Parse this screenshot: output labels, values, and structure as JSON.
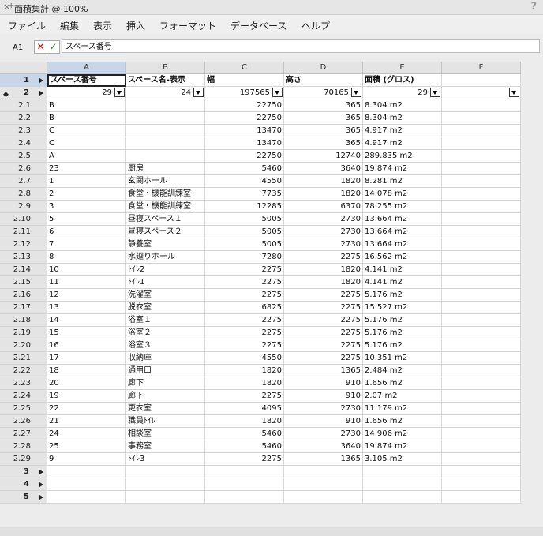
{
  "window": {
    "title": "面積集計 @ 100%",
    "help": "?"
  },
  "menu": [
    "ファイル",
    "編集",
    "表示",
    "挿入",
    "フォーマット",
    "データベース",
    "ヘルプ"
  ],
  "formula": {
    "cell_ref": "A1",
    "cancel": "✕",
    "accept": "✓",
    "value": "スペース番号"
  },
  "columns": [
    "A",
    "B",
    "C",
    "D",
    "E",
    "F"
  ],
  "header_row": {
    "num": "1",
    "cells": [
      "スペース番号",
      "スペース名-表示",
      "幅",
      "高さ",
      "面積 (グロス)",
      ""
    ]
  },
  "summary_row": {
    "num": "2",
    "cells": [
      "29",
      "24",
      "197565",
      "70165",
      "29",
      ""
    ]
  },
  "records": [
    {
      "n": "2.1",
      "c": [
        "B",
        "",
        "22750",
        "365",
        "8.304 m2"
      ]
    },
    {
      "n": "2.2",
      "c": [
        "B",
        "",
        "22750",
        "365",
        "8.304 m2"
      ]
    },
    {
      "n": "2.3",
      "c": [
        "C",
        "",
        "13470",
        "365",
        "4.917 m2"
      ]
    },
    {
      "n": "2.4",
      "c": [
        "C",
        "",
        "13470",
        "365",
        "4.917 m2"
      ]
    },
    {
      "n": "2.5",
      "c": [
        "A",
        "",
        "22750",
        "12740",
        "289.835 m2"
      ]
    },
    {
      "n": "2.6",
      "c": [
        "23",
        "厨房",
        "5460",
        "3640",
        "19.874 m2"
      ]
    },
    {
      "n": "2.7",
      "c": [
        "1",
        "玄関ホール",
        "4550",
        "1820",
        "8.281 m2"
      ]
    },
    {
      "n": "2.8",
      "c": [
        "2",
        "食堂・機能訓練室",
        "7735",
        "1820",
        "14.078 m2"
      ]
    },
    {
      "n": "2.9",
      "c": [
        "3",
        "食堂・機能訓練室",
        "12285",
        "6370",
        "78.255 m2"
      ]
    },
    {
      "n": "2.10",
      "c": [
        "5",
        "昼寝スペース１",
        "5005",
        "2730",
        "13.664 m2"
      ]
    },
    {
      "n": "2.11",
      "c": [
        "6",
        "昼寝スペース２",
        "5005",
        "2730",
        "13.664 m2"
      ]
    },
    {
      "n": "2.12",
      "c": [
        "7",
        "静養室",
        "5005",
        "2730",
        "13.664 m2"
      ]
    },
    {
      "n": "2.13",
      "c": [
        "8",
        "水廻りホール",
        "7280",
        "2275",
        "16.562 m2"
      ]
    },
    {
      "n": "2.14",
      "c": [
        "10",
        "ﾄｲﾚ2",
        "2275",
        "1820",
        "4.141 m2"
      ]
    },
    {
      "n": "2.15",
      "c": [
        "11",
        "ﾄｲﾚ1",
        "2275",
        "1820",
        "4.141 m2"
      ]
    },
    {
      "n": "2.16",
      "c": [
        "12",
        "洗濯室",
        "2275",
        "2275",
        "5.176 m2"
      ]
    },
    {
      "n": "2.17",
      "c": [
        "13",
        "脱衣室",
        "6825",
        "2275",
        "15.527 m2"
      ]
    },
    {
      "n": "2.18",
      "c": [
        "14",
        "浴室１",
        "2275",
        "2275",
        "5.176 m2"
      ]
    },
    {
      "n": "2.19",
      "c": [
        "15",
        "浴室２",
        "2275",
        "2275",
        "5.176 m2"
      ]
    },
    {
      "n": "2.20",
      "c": [
        "16",
        "浴室３",
        "2275",
        "2275",
        "5.176 m2"
      ]
    },
    {
      "n": "2.21",
      "c": [
        "17",
        "収納庫",
        "4550",
        "2275",
        "10.351 m2"
      ]
    },
    {
      "n": "2.22",
      "c": [
        "18",
        "通用口",
        "1820",
        "1365",
        "2.484 m2"
      ]
    },
    {
      "n": "2.23",
      "c": [
        "20",
        "廊下",
        "1820",
        "910",
        "1.656 m2"
      ]
    },
    {
      "n": "2.24",
      "c": [
        "19",
        "廊下",
        "2275",
        "910",
        "2.07 m2"
      ]
    },
    {
      "n": "2.25",
      "c": [
        "22",
        "更衣室",
        "4095",
        "2730",
        "11.179 m2"
      ]
    },
    {
      "n": "2.26",
      "c": [
        "21",
        "職員ﾄｲﾚ",
        "1820",
        "910",
        "1.656 m2"
      ]
    },
    {
      "n": "2.27",
      "c": [
        "24",
        "相談室",
        "5460",
        "2730",
        "14.906 m2"
      ]
    },
    {
      "n": "2.28",
      "c": [
        "25",
        "事務室",
        "5460",
        "3640",
        "19.874 m2"
      ]
    },
    {
      "n": "2.29",
      "c": [
        "9",
        "ﾄｲﾚ3",
        "2275",
        "1365",
        "3.105 m2"
      ]
    }
  ],
  "empty_rows": [
    "3",
    "4",
    "5"
  ]
}
